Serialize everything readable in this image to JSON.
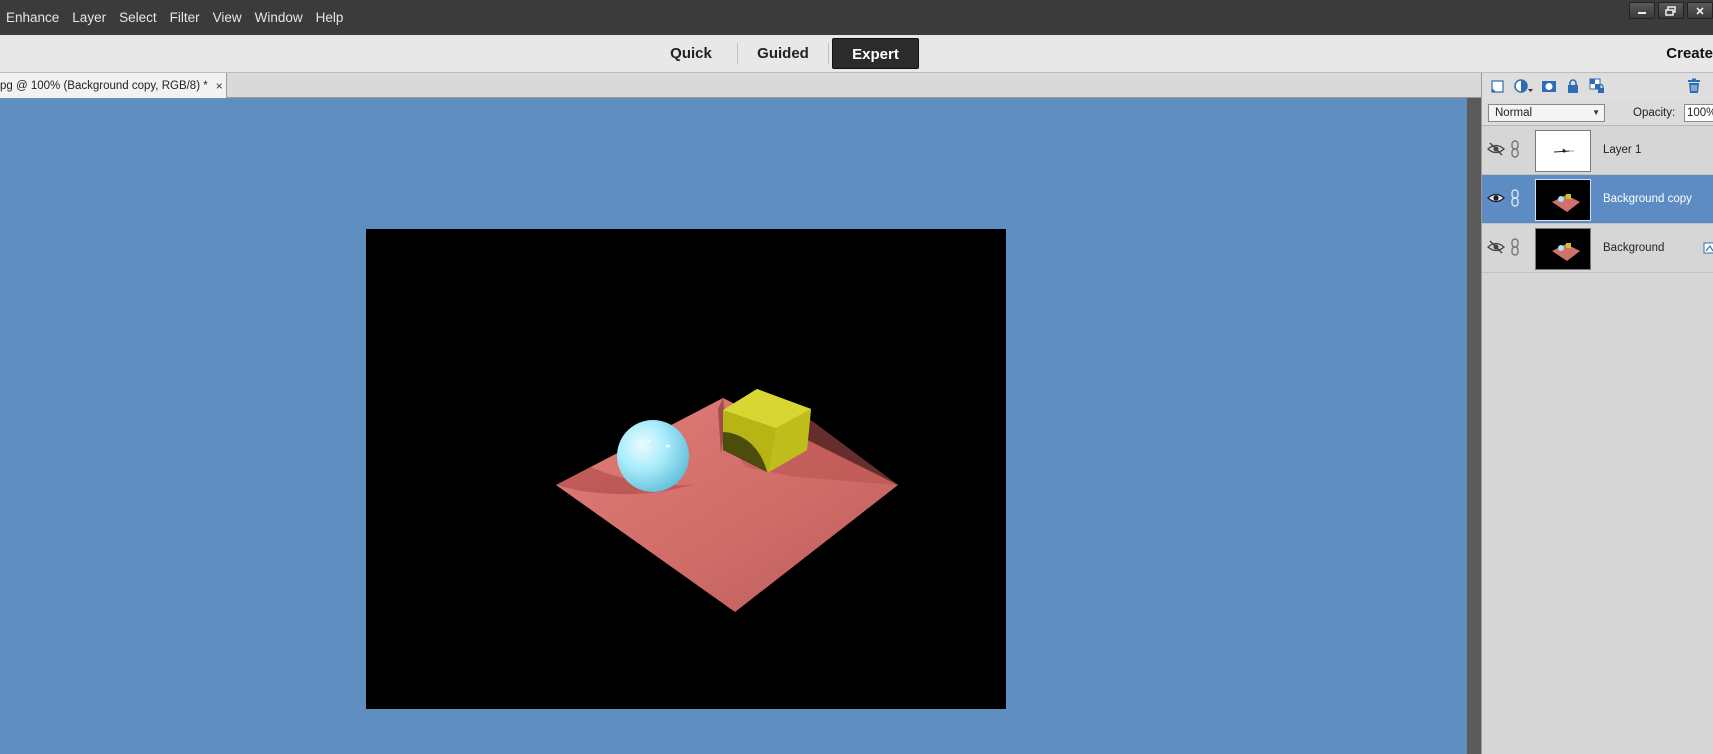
{
  "menubar": {
    "items": [
      "Enhance",
      "Layer",
      "Select",
      "Filter",
      "View",
      "Window",
      "Help"
    ],
    "window_controls": [
      "minimize-icon",
      "restore-icon",
      "close-icon"
    ]
  },
  "modes": {
    "tabs": [
      {
        "label": "Quick",
        "active": false
      },
      {
        "label": "Guided",
        "active": false
      },
      {
        "label": "Expert",
        "active": true
      }
    ],
    "create_label": "Create"
  },
  "document": {
    "tab_title": "pg @ 100% (Background copy, RGB/8) *",
    "close_glyph": "×"
  },
  "layers_panel": {
    "toolbar_icons": [
      "new-layer-icon",
      "adjustment-layer-icon",
      "layer-mask-icon",
      "lock-all-icon",
      "lock-transparency-icon",
      "delete-layer-icon"
    ],
    "blend_mode": "Normal",
    "opacity_label": "Opacity:",
    "opacity_value": "100%",
    "layers": [
      {
        "name": "Layer 1",
        "visible": false,
        "selected": false,
        "thumbnail": "white"
      },
      {
        "name": "Background copy",
        "visible": true,
        "selected": true,
        "thumbnail": "scene"
      },
      {
        "name": "Background",
        "visible": false,
        "selected": false,
        "thumbnail": "scene"
      }
    ]
  },
  "colors": {
    "canvas_background": "#5f8fc0",
    "selected_layer": "#5d8cc4",
    "menubar": "#3b3b3b",
    "plane": "#d2706c",
    "sphere": "#9fe6f6",
    "cube": "#c9c81a"
  }
}
